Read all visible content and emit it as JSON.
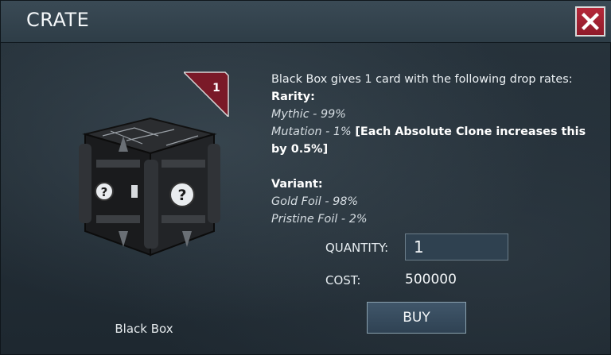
{
  "dialog": {
    "title": "CRATE"
  },
  "crate": {
    "name": "Black Box",
    "count": "1"
  },
  "description": {
    "intro": "Black Box gives 1 card with the following drop rates:",
    "rarity_heading": "Rarity:",
    "rarity_mythic": "Mythic - 99%",
    "rarity_mutation": "Mutation - 1%",
    "rarity_note": "[Each Absolute Clone increases this by 0.5%]",
    "variant_heading": "Variant:",
    "variant_gold": "Gold Foil - 98%",
    "variant_pristine": "Pristine Foil - 2%"
  },
  "purchase": {
    "quantity_label": "QUANTITY:",
    "quantity_value": "1",
    "cost_label": "COST:",
    "cost_value": "500000",
    "buy_label": "BUY"
  },
  "colors": {
    "close_red": "#a5203a",
    "ribbon_red": "#7a1a28",
    "panel": "#1f2a33"
  },
  "icons": {
    "close": "close-icon",
    "crate": "black-box-crate-image",
    "question": "question-mark-icon"
  }
}
